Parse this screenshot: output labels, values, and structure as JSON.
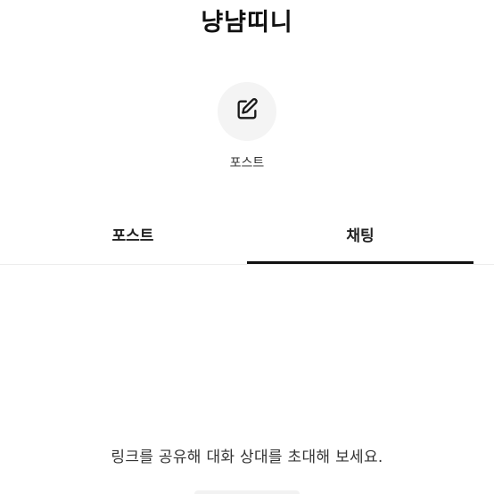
{
  "profile": {
    "name": "냥냠띠니"
  },
  "actions": [
    {
      "label": "포스트",
      "icon": "edit-icon"
    }
  ],
  "tabs": [
    {
      "label": "포스트",
      "active": false
    },
    {
      "label": "채팅",
      "active": true
    }
  ],
  "chat": {
    "empty_message": "링크를 공유해 대화 상대를 초대해 보세요."
  },
  "colors": {
    "text": "#111111",
    "icon_bg": "#f4f4f4",
    "active_underline": "#111111",
    "divider": "#ececec"
  }
}
